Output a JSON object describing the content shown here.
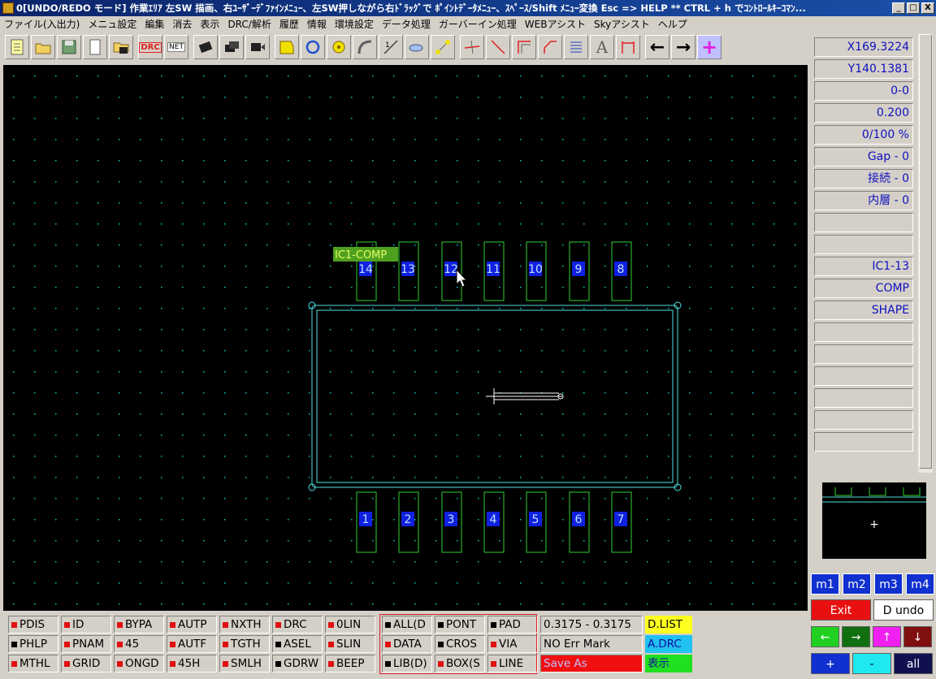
{
  "window": {
    "title": "0[UNDO/REDO モード] 作業ｴﾘｱ 左SW 描画、右ﾕｰｻﾞｰﾃﾞﾌｧｲﾝﾒﾆｭｰ、左SW押しながら右ﾄﾞﾗｯｸﾞで ﾎﾟｲﾝﾄﾃﾞｰﾀﾒﾆｭｰ、ｽﾍﾟｰｽ/Shift ﾒﾆｭｰ変換 Esc => HELP ** CTRL + h でｺﾝﾄﾛｰﾙｷｰｺﾏﾝ...",
    "minimize": "_",
    "maximize": "□",
    "close": "X"
  },
  "menu": [
    "ファイル(入出力)",
    "メニュ設定",
    "編集",
    "消去",
    "表示",
    "DRC/解析",
    "履歴",
    "情報",
    "環境設定",
    "データ処理",
    "ガーバーイン処理",
    "WEBアシスト",
    "Skyアシスト",
    "ヘルプ"
  ],
  "toolbar": {
    "drc": "DRC",
    "net": "NET",
    "text_a": "A",
    "arrow_left": "←",
    "arrow_right": "→",
    "plus": "+"
  },
  "panel": {
    "x": "X169.3224",
    "y": "Y140.1381",
    "layer": "0-0",
    "width": "0.200",
    "percent": "0/100 %",
    "gap": "Gap  -  0",
    "connect": "接続  -  0",
    "inner": "内層  -  0",
    "blank1": "",
    "blank2": "",
    "ref": "IC1-13",
    "type": "COMP",
    "shape": "SHAPE"
  },
  "component": {
    "label": "IC1-COMP",
    "top_pins": [
      "14",
      "13",
      "12",
      "11",
      "10",
      "9",
      "8"
    ],
    "bottom_pins": [
      "1",
      "2",
      "3",
      "4",
      "5",
      "6",
      "7"
    ]
  },
  "preview": {
    "crosshair": "+"
  },
  "mbuttons": [
    "m1",
    "m2",
    "m3",
    "m4"
  ],
  "controls": {
    "exit": "Exit",
    "dundo": "D undo",
    "left": "←",
    "right": "→",
    "up": "↑",
    "down": "↓",
    "plus": "+",
    "minus": "-",
    "all": "all"
  },
  "status_rows": [
    [
      "PDIS",
      "ID",
      "BYPA",
      "AUTP",
      "NXTH",
      "DRC",
      "0LIN"
    ],
    [
      "PHLP",
      "PNAM",
      "45",
      "AUTF",
      "TGTH",
      "ASEL",
      "SLIN"
    ],
    [
      "MTHL",
      "GRID",
      "ONGD",
      "45H",
      "SMLH",
      "GDRW",
      "BEEP"
    ]
  ],
  "status_marks": [
    [
      "red",
      "red",
      "red",
      "red",
      "red",
      "red",
      "red"
    ],
    [
      "black",
      "red",
      "red",
      "red",
      "red",
      "black",
      "red"
    ],
    [
      "red",
      "red",
      "red",
      "red",
      "red",
      "black",
      "red"
    ]
  ],
  "filter_rows": [
    [
      "ALL(D",
      "PONT",
      "PAD"
    ],
    [
      "DATA",
      "CROS",
      "VIA"
    ],
    [
      "LIB(D)",
      "BOX(S",
      "LINE"
    ]
  ],
  "filter_marks": [
    [
      "black",
      "black",
      "black"
    ],
    [
      "red",
      "black",
      "red"
    ],
    [
      "black",
      "red",
      "red"
    ]
  ],
  "info": {
    "range": "0.3175 - 0.3175",
    "errmark": "NO Err Mark",
    "saveas": "Save As",
    "dlist": "D.LIST",
    "adrc": "A.DRC",
    "display": "表示"
  },
  "colors": {
    "grid": "#00c8c8",
    "pad": "#30d030",
    "pin_label_bg": "#1020e0",
    "outline": "#50e0e0",
    "label_bg": "#50a020",
    "label_text": "#e0ff60"
  }
}
